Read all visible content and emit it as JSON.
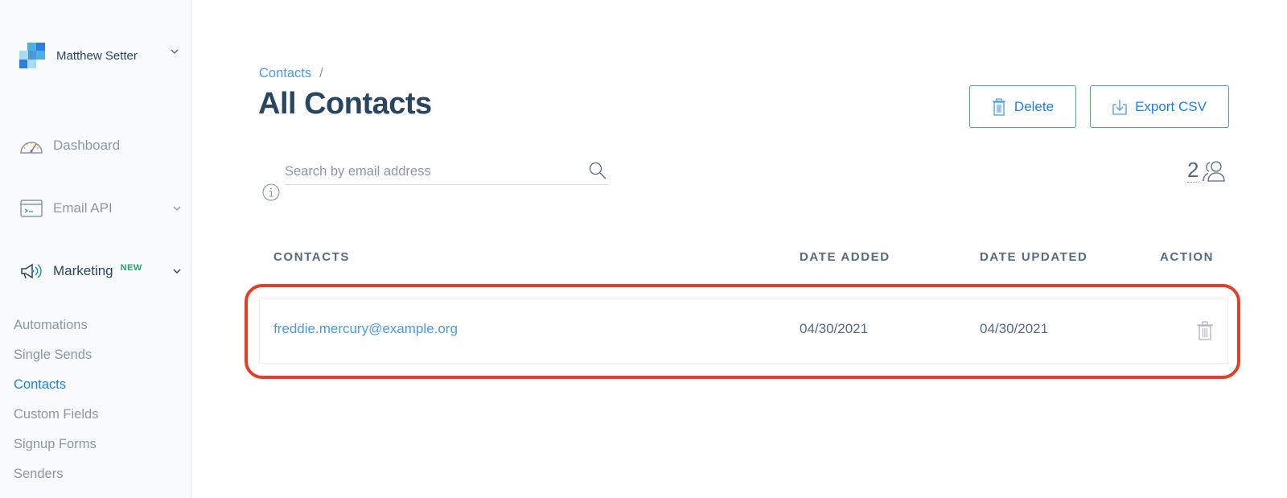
{
  "sidebar": {
    "account": {
      "name": "Matthew Setter",
      "logo_colors": [
        "#2e7ce0",
        "#4db1e6",
        "#a8dcf5",
        "#4ea3e0"
      ]
    },
    "nav": [
      {
        "label": "Dashboard",
        "icon": "dashboard-gauge-icon"
      },
      {
        "label": "Email API",
        "icon": "terminal-window-icon",
        "has_chevron": true
      },
      {
        "label": "Marketing",
        "icon": "megaphone-icon",
        "badge": "NEW",
        "has_chevron": true
      }
    ],
    "sub_items": [
      {
        "label": "Automations",
        "active": false
      },
      {
        "label": "Single Sends",
        "active": false
      },
      {
        "label": "Contacts",
        "active": true
      },
      {
        "label": "Custom Fields",
        "active": false
      },
      {
        "label": "Signup Forms",
        "active": false
      },
      {
        "label": "Senders",
        "active": false
      }
    ]
  },
  "header": {
    "breadcrumb": {
      "link": "Contacts",
      "separator": "/"
    },
    "title": "All Contacts",
    "buttons": {
      "delete": "Delete",
      "export": "Export CSV"
    }
  },
  "search": {
    "placeholder": "Search by email address",
    "value": ""
  },
  "contact_count": "2",
  "table": {
    "columns": [
      "CONTACTS",
      "DATE ADDED",
      "DATE UPDATED",
      "ACTION"
    ],
    "rows": [
      {
        "email": "freddie.mercury@example.org",
        "date_added": "04/30/2021",
        "date_updated": "04/30/2021"
      }
    ]
  },
  "colors": {
    "accent": "#1a82e2",
    "link": "#4a9be6",
    "heading": "#294661",
    "muted": "#8a97a8",
    "new_badge": "#1aa86a",
    "highlight": "#e73c25"
  }
}
